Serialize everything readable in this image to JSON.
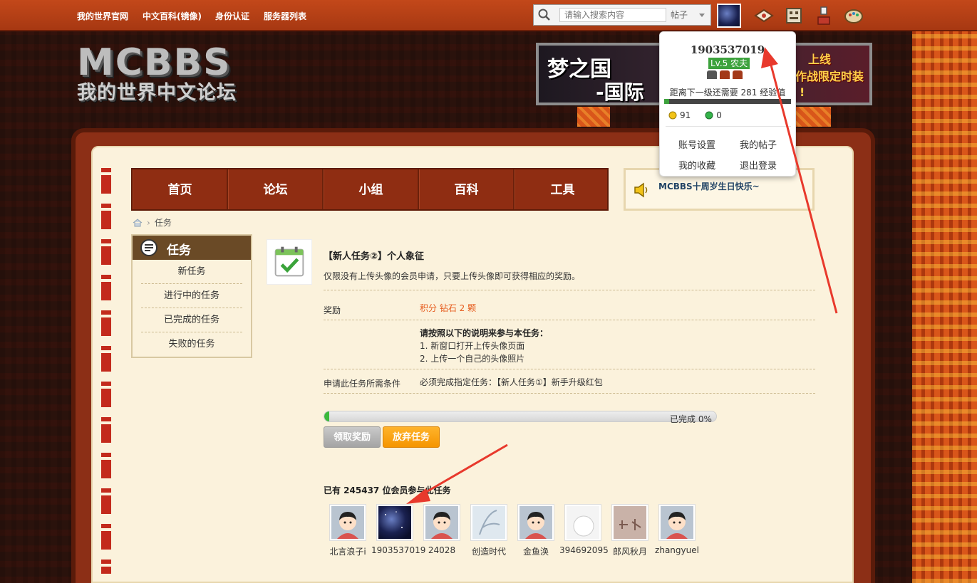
{
  "topbar": {
    "links": [
      "我的世界官网",
      "中文百科(镜像)",
      "身份认证",
      "服务器列表"
    ],
    "search_placeholder": "请输入搜索内容",
    "search_type": "帖子"
  },
  "logo": {
    "main": "MCBBS",
    "sub": "我的世界中文论坛"
  },
  "banner": {
    "title": "梦之国",
    "subtitle": "-国际",
    "right_line1": "上线",
    "right_line2": "作战限定时装",
    "right_line3": "!"
  },
  "nav": {
    "items": [
      "首页",
      "论坛",
      "小组",
      "百科",
      "工具"
    ],
    "notice": "MCBBS十周岁生日快乐~"
  },
  "breadcrumb": {
    "current": "任务"
  },
  "sidebar": {
    "title": "任务",
    "items": [
      "新任务",
      "进行中的任务",
      "已完成的任务",
      "失败的任务"
    ]
  },
  "task": {
    "title": "【新人任务②】个人象征",
    "description": "仅限没有上传头像的会员申请，只要上传头像即可获得相应的奖励。",
    "reward_label": "奖励",
    "reward_value": "积分 钻石 2 颗",
    "instructions_title": "请按照以下的说明来参与本任务：",
    "instructions": [
      "1. 新窗口打开上传头像页面",
      "2. 上传一个自己的头像照片"
    ],
    "condition_label": "申请此任务所需条件",
    "condition_value": "必须完成指定任务：【新人任务①】新手升级红包",
    "progress_percent": 0,
    "progress_text": "已完成 0%",
    "claim_button": "领取奖励",
    "abandon_button": "放弃任务"
  },
  "members": {
    "title": "已有 245437 位会员参与此任务",
    "list": [
      {
        "name": "北言浪子i",
        "avatar": "default"
      },
      {
        "name": "1903537019",
        "avatar": "galaxy"
      },
      {
        "name": "24028",
        "avatar": "default"
      },
      {
        "name": "创造时代",
        "avatar": "sketch"
      },
      {
        "name": "金鱼涣",
        "avatar": "default"
      },
      {
        "name": "394692095",
        "avatar": "white"
      },
      {
        "name": "郎风秋月",
        "avatar": "calligraphy"
      },
      {
        "name": "zhangyuel",
        "avatar": "default"
      }
    ]
  },
  "user_menu": {
    "username": "1903537019",
    "level": "Lv.5 农夫",
    "next_level_text": "距离下一级还需要 281 经验值",
    "level_progress_percent": 4,
    "gold": "91",
    "emerald": "0",
    "links": [
      "账号设置",
      "我的帖子",
      "我的收藏",
      "退出登录"
    ]
  },
  "colors": {
    "topbar": "#b54015",
    "nav": "#8f2d12",
    "paper": "#fbf2dc",
    "accent_orange": "#f59500",
    "reward_text": "#e65b1d",
    "level_green": "#3da23d",
    "arrow_red": "#e8392c"
  }
}
